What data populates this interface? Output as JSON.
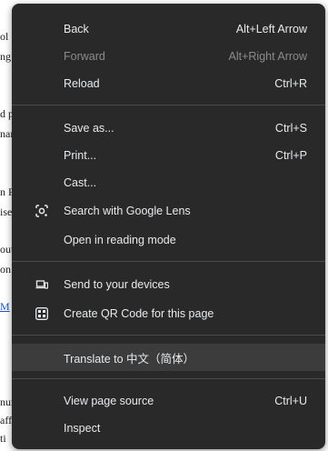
{
  "background_page": {
    "fragments": [
      {
        "text": "ol",
        "link": false
      },
      {
        "text": "ng",
        "link": false
      },
      {
        "text": "d p",
        "link": false
      },
      {
        "text": "nar",
        "link": false
      },
      {
        "text": "n F",
        "link": false
      },
      {
        "text": "ise",
        "link": false
      },
      {
        "text": "out",
        "link": false
      },
      {
        "text": "on",
        "link": false
      },
      {
        "text": "M",
        "link": true
      },
      {
        "text": "nur",
        "link": false
      },
      {
        "text": "aff",
        "link": false
      },
      {
        "text": "ti",
        "link": false
      }
    ]
  },
  "context_menu": {
    "items": {
      "back": {
        "label": "Back",
        "shortcut": "Alt+Left Arrow"
      },
      "forward": {
        "label": "Forward",
        "shortcut": "Alt+Right Arrow",
        "disabled": true
      },
      "reload": {
        "label": "Reload",
        "shortcut": "Ctrl+R"
      },
      "save_as": {
        "label": "Save as...",
        "shortcut": "Ctrl+S"
      },
      "print": {
        "label": "Print...",
        "shortcut": "Ctrl+P"
      },
      "cast": {
        "label": "Cast..."
      },
      "google_lens": {
        "label": "Search with Google Lens",
        "icon": "google-lens-icon"
      },
      "reading_mode": {
        "label": "Open in reading mode"
      },
      "send_devices": {
        "label": "Send to your devices",
        "icon": "devices-icon"
      },
      "qr_code": {
        "label": "Create QR Code for this page",
        "icon": "qr-code-icon"
      },
      "translate": {
        "label": "Translate to 中文（简体）",
        "highlighted": true
      },
      "view_source": {
        "label": "View page source",
        "shortcut": "Ctrl+U"
      },
      "inspect": {
        "label": "Inspect"
      }
    }
  },
  "colors": {
    "menu_bg": "#292929",
    "menu_text": "#e8eaed",
    "disabled_text": "#8a8b8d",
    "hover_bg": "#3c3c3c",
    "separator": "#4a4a4a",
    "link": "#1a56c4"
  }
}
